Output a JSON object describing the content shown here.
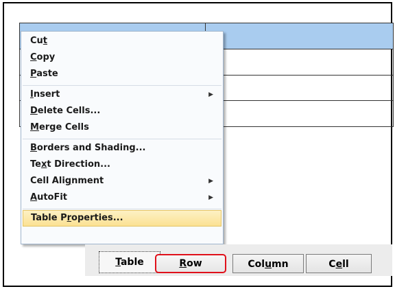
{
  "context_menu": {
    "items": [
      {
        "pre": "Cu",
        "u": "t",
        "post": "",
        "submenu": false
      },
      {
        "pre": "",
        "u": "C",
        "post": "opy",
        "submenu": false
      },
      {
        "pre": "",
        "u": "P",
        "post": "aste",
        "submenu": false
      },
      {
        "pre": "",
        "u": "I",
        "post": "nsert",
        "submenu": true
      },
      {
        "pre": "",
        "u": "D",
        "post": "elete Cells...",
        "submenu": false
      },
      {
        "pre": "",
        "u": "M",
        "post": "erge Cells",
        "submenu": false
      },
      {
        "pre": "",
        "u": "B",
        "post": "orders and Shading...",
        "submenu": false
      },
      {
        "pre": "Te",
        "u": "x",
        "post": "t Direction...",
        "submenu": false
      },
      {
        "pre": "Cell Ali",
        "u": "g",
        "post": "nment",
        "submenu": true
      },
      {
        "pre": "",
        "u": "A",
        "post": "utoFit",
        "submenu": true
      },
      {
        "pre": "Table P",
        "u": "r",
        "post": "operties...",
        "submenu": false,
        "highlighted": true
      }
    ],
    "submenu_arrow": "▶"
  },
  "tabs": [
    {
      "pre": "",
      "u": "T",
      "post": "able"
    },
    {
      "pre": "",
      "u": "R",
      "post": "ow"
    },
    {
      "pre": "Col",
      "u": "u",
      "post": "mn"
    },
    {
      "pre": "C",
      "u": "e",
      "post": "ll"
    }
  ],
  "colors": {
    "table_header": "#a9ccef",
    "menu_highlight": "#fbe193",
    "row_tab_outline": "#e0101a"
  }
}
